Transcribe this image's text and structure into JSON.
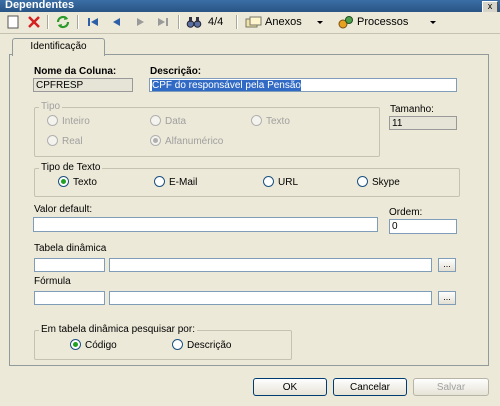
{
  "window": {
    "title": "Dependentes",
    "close_glyph": "x"
  },
  "toolbar": {
    "record_counter": "4/4",
    "anexos_label": "Anexos",
    "processos_label": "Processos"
  },
  "tabs": [
    {
      "label": "Identificação"
    }
  ],
  "form": {
    "column_name_label": "Nome da Coluna:",
    "column_name_value": "CPFRESP",
    "description_label": "Descrição:",
    "description_value": "CPF do responsável pela Pensão",
    "tipo": {
      "legend": "Tipo",
      "options": [
        {
          "label": "Inteiro",
          "selected": false
        },
        {
          "label": "Data",
          "selected": false
        },
        {
          "label": "Texto",
          "selected": false
        },
        {
          "label": "Real",
          "selected": false
        },
        {
          "label": "Alfanumérico",
          "selected": true
        }
      ]
    },
    "tamanho_label": "Tamanho:",
    "tamanho_value": "11",
    "tipo_texto": {
      "legend": "Tipo de Texto",
      "options": [
        {
          "label": "Texto",
          "selected": true
        },
        {
          "label": "E-Mail",
          "selected": false
        },
        {
          "label": "URL",
          "selected": false
        },
        {
          "label": "Skype",
          "selected": false
        }
      ]
    },
    "valor_default_label": "Valor default:",
    "valor_default_value": "",
    "ordem_label": "Ordem:",
    "ordem_value": "0",
    "tabela_dinamica_label": "Tabela dinâmica",
    "formula_label": "Fórmula",
    "ellipsis": "...",
    "pesquisar": {
      "legend": "Em tabela dinâmica pesquisar por:",
      "options": [
        {
          "label": "Código",
          "selected": true
        },
        {
          "label": "Descrição",
          "selected": false
        }
      ]
    }
  },
  "buttons": {
    "ok": "OK",
    "cancel": "Cancelar",
    "save": "Salvar"
  }
}
